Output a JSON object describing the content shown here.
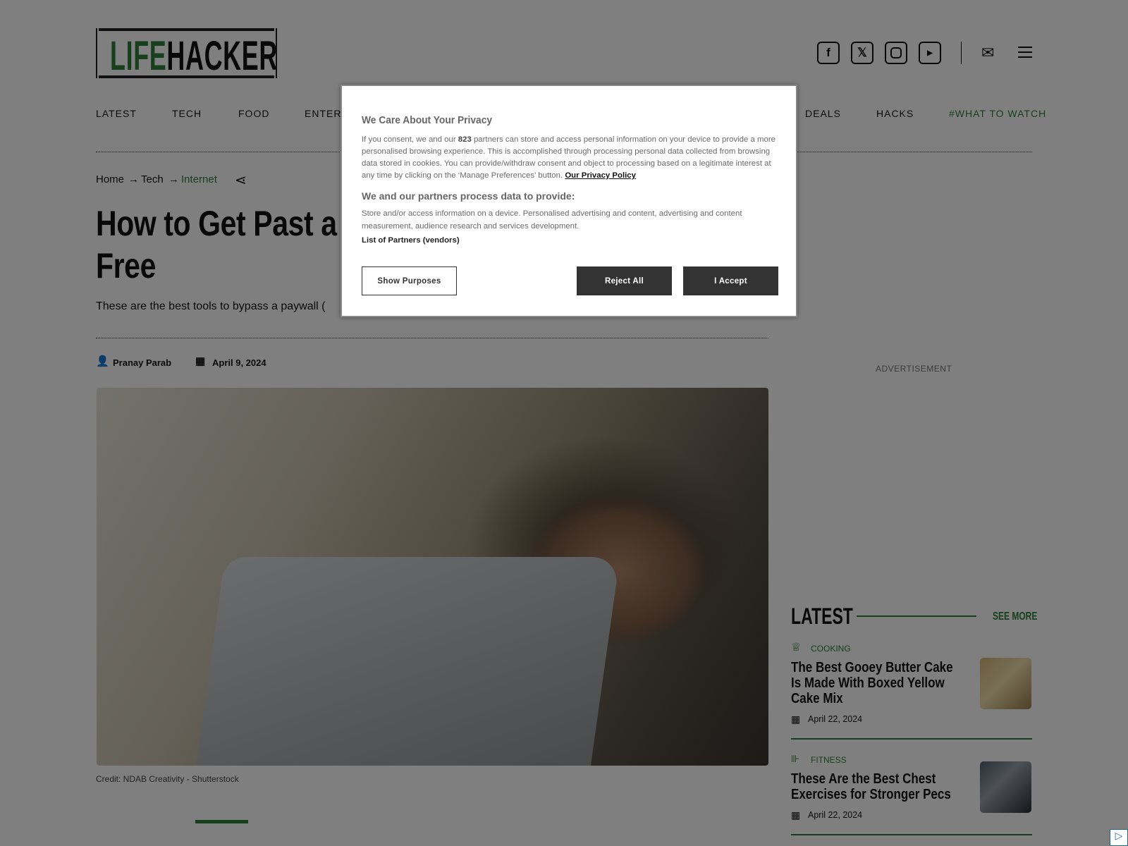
{
  "header": {
    "logo_green": "LIFE",
    "logo_dark": "HACKER",
    "social": [
      "facebook-icon",
      "x-icon",
      "instagram-icon",
      "youtube-icon"
    ]
  },
  "nav": {
    "items": [
      "LATEST",
      "TECH",
      "FOOD",
      "ENTERTAINMENT",
      "DEALS",
      "HACKS",
      "#WHAT TO WATCH"
    ],
    "highlight_color": "#2f7d3a"
  },
  "breadcrumb": [
    "Home",
    "Tech",
    "Internet"
  ],
  "article": {
    "title_line1": "How to Get Past a",
    "title_line2": "Free",
    "dek": "These are the best tools to bypass a paywall (",
    "author": "Pranay Parab",
    "date": "April 9, 2024",
    "credit": "Credit: NDAB Creativity - Shutterstock"
  },
  "sidebar": {
    "ad_label": "ADVERTISEMENT",
    "latest_heading": "LATEST",
    "see_more": "SEE MORE",
    "items": [
      {
        "category": "COOKING",
        "title": "The Best Gooey Butter Cake Is Made With Boxed Yellow Cake Mix",
        "date": "April 22, 2024"
      },
      {
        "category": "FITNESS",
        "title": "These Are the Best Chest Exercises for Stronger Pecs",
        "date": "April 22, 2024"
      }
    ]
  },
  "consent": {
    "title": "We Care About Your Privacy",
    "body_pre": "If you consent, we and our ",
    "partners_count": "823",
    "body_post": " partners can store and access personal information on your device to provide a more personalised browsing experience. This is accomplished through processing personal data collected from browsing data stored in cookies. You can provide/withdraw consent and object to processing based on a legitimate interest at any time by clicking on the ‘Manage Preferences’ button. ",
    "policy_link": "Our Privacy Policy",
    "subtitle": "We and our partners process data to provide:",
    "purposes": "Store and/or access information on a device. Personalised advertising and content, advertising and content measurement, audience research and services development.",
    "partners_link": "List of Partners (vendors)",
    "show_purposes": "Show Purposes",
    "reject": "Reject All",
    "accept": "I Accept"
  }
}
